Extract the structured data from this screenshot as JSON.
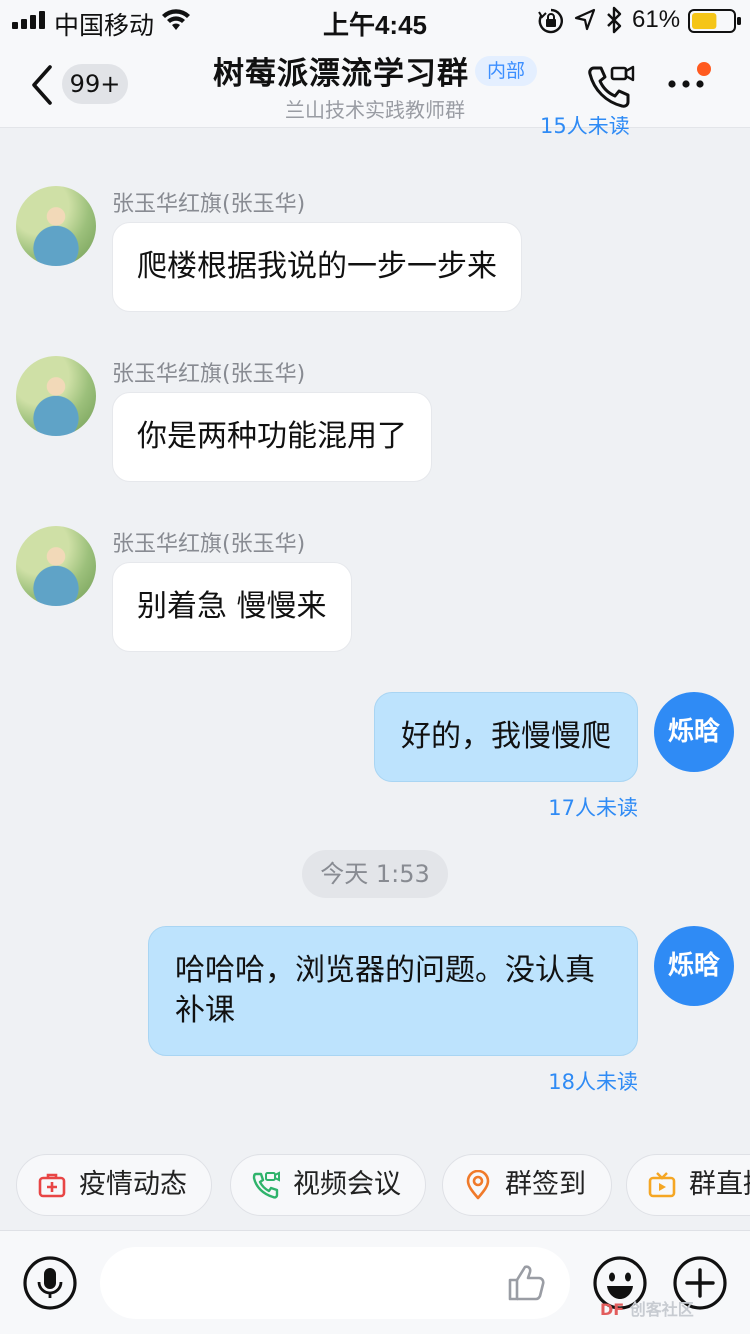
{
  "status_bar": {
    "carrier": "中国移动",
    "time": "上午4:45",
    "battery_pct": "61%",
    "battery_level": 0.61,
    "icons": [
      "signal-icon",
      "wifi-icon",
      "orientation-lock-icon",
      "location-arrow-icon",
      "bluetooth-icon",
      "battery-icon"
    ]
  },
  "nav": {
    "back_badge": "99+",
    "title": "树莓派漂流学习群",
    "tag": "内部",
    "subtitle": "兰山技术实践教师群",
    "icons": [
      "back-chevron-icon",
      "video-call-icon",
      "more-icon"
    ],
    "accent": "#ff5a1f"
  },
  "chat": {
    "peek_read_count": "15人未读",
    "incoming": [
      {
        "sender": "张玉华红旗(张玉华)",
        "text": "爬楼根据我说的一步一步来"
      },
      {
        "sender": "张玉华红旗(张玉华)",
        "text": "你是两种功能混用了"
      },
      {
        "sender": "张玉华红旗(张玉华)",
        "text": "别着急 慢慢来"
      }
    ],
    "outgoing": [
      {
        "avatar_text": "烁晗",
        "text": "好的，我慢慢爬",
        "read_count": "17人未读"
      },
      {
        "avatar_text": "烁晗",
        "text": "哈哈哈，浏览器的问题。没认真补课",
        "read_count": "18人未读"
      }
    ],
    "time_divider": "今天 1:53",
    "colors": {
      "outgoing_bubble": "#bde3fd",
      "incoming_bubble": "#ffffff",
      "accent_blue": "#2f8bf5"
    }
  },
  "quick_actions": [
    {
      "label": "疫情动态",
      "icon": "medical-kit-icon",
      "color": "#e84545"
    },
    {
      "label": "视频会议",
      "icon": "video-phone-icon",
      "color": "#2fb36b"
    },
    {
      "label": "群签到",
      "icon": "location-pin-icon",
      "color": "#f07a2a"
    },
    {
      "label": "群直播",
      "icon": "tv-icon",
      "color": "#f5a623"
    }
  ],
  "input_bar": {
    "placeholder": "",
    "icons": [
      "microphone-icon",
      "thumbs-up-icon",
      "emoji-icon",
      "plus-icon"
    ]
  },
  "watermark": {
    "brand": "DF",
    "text": "创客社区"
  }
}
